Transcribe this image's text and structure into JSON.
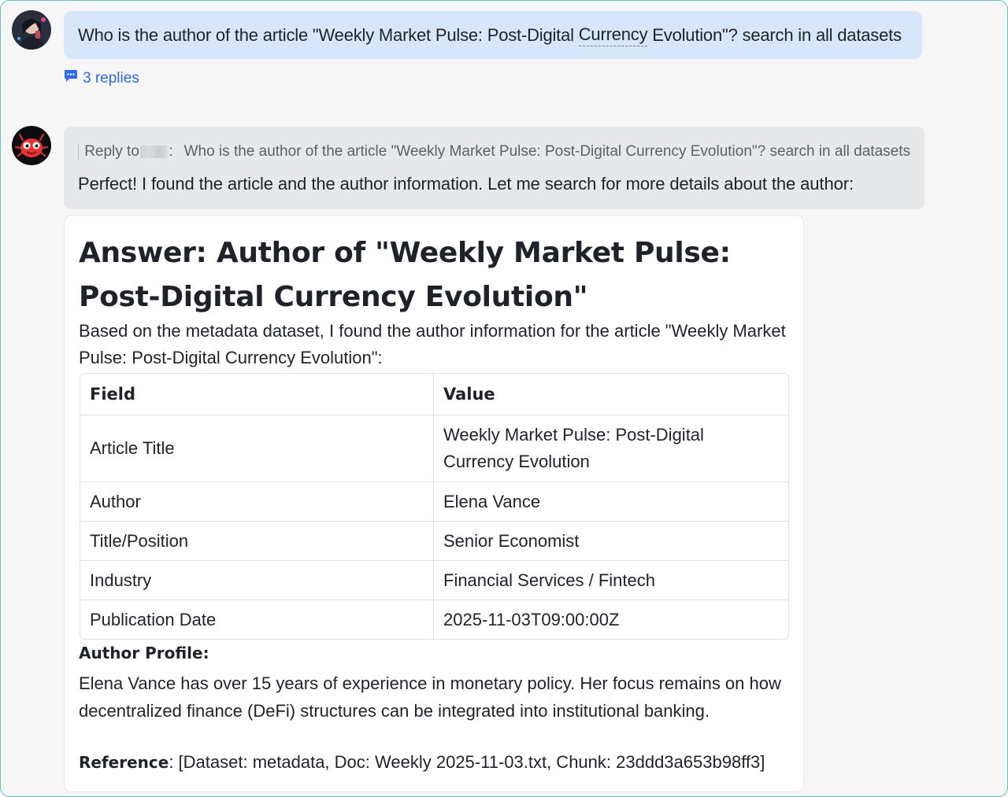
{
  "user_message": {
    "text_before": "Who is the author of the article \"Weekly Market Pulse: Post-Digital ",
    "underlined": "Currency",
    "text_after": " Evolution\"? search in all datasets"
  },
  "thread": {
    "replies_label": "3 replies",
    "icon": "chat-bubble-icon"
  },
  "bot_message": {
    "reply_prefix": "Reply to",
    "reply_separator": ":",
    "reply_quote": "Who is the author of the article \"Weekly Market Pulse: Post-Digital Currency Evolution\"? search in all datasets",
    "text": "Perfect! I found the article and the author information. Let me search for more details about the author:"
  },
  "answer": {
    "heading": "Answer: Author of \"Weekly Market Pulse: Post-Digital Currency Evolution\"",
    "intro": "Based on the metadata dataset, I found the author information for the article \"Weekly Market Pulse: Post-Digital Currency Evolution\":",
    "table": {
      "headers": [
        "Field",
        "Value"
      ],
      "rows": [
        [
          "Article Title",
          "Weekly Market Pulse: Post-Digital Currency Evolution"
        ],
        [
          "Author",
          "Elena Vance"
        ],
        [
          "Title/Position",
          "Senior Economist"
        ],
        [
          "Industry",
          "Financial Services / Fintech"
        ],
        [
          "Publication Date",
          "2025-11-03T09:00:00Z"
        ]
      ]
    },
    "profile_heading": "Author Profile:",
    "profile_text": "Elena Vance has over 15 years of experience in monetary policy. Her focus remains on how decentralized finance (DeFi) structures can be integrated into institutional banking.",
    "reference_label": "Reference",
    "reference_text": ": [Dataset: metadata, Doc: Weekly 2025-11-03.txt, Chunk: 23ddd3a653b98ff3]"
  },
  "colors": {
    "user_bubble": "#d7e6fb",
    "bot_bubble": "#e7e8ea",
    "link": "#2d6ae3",
    "frame_border": "#5cc6b8"
  }
}
